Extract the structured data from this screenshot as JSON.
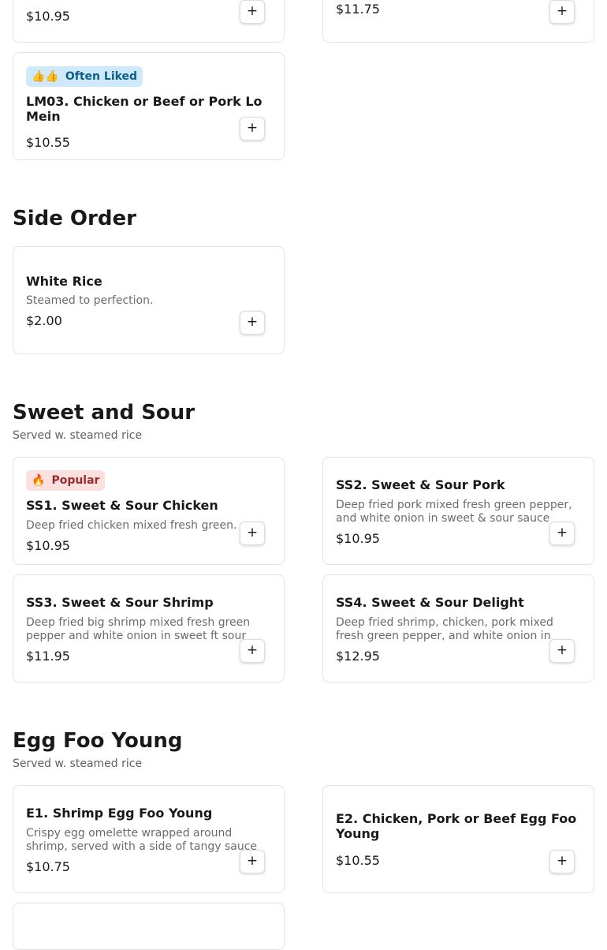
{
  "top_partial": {
    "left": {
      "price": "$10.95",
      "add_label": "+"
    },
    "right": {
      "price": "$11.75",
      "add_label": "+"
    }
  },
  "lomein": {
    "badge": {
      "icon": "👍👍",
      "label": "Often Liked"
    },
    "name": "LM03. Chicken or Beef or Pork Lo Mein",
    "price": "$10.55",
    "add_label": "+"
  },
  "side_order": {
    "title": "Side Order",
    "items": [
      {
        "name": "White Rice",
        "description": "Steamed to perfection.",
        "price": "$2.00",
        "add_label": "+"
      }
    ]
  },
  "sweet_sour": {
    "title": "Sweet and Sour",
    "subtitle": "Served w. steamed rice",
    "items": [
      {
        "badge": {
          "icon": "🔥",
          "label": "Popular"
        },
        "name": "SS1. Sweet & Sour Chicken",
        "description": "Deep fried chicken mixed fresh green.",
        "price": "$10.95",
        "add_label": "+"
      },
      {
        "name": "SS2. Sweet & Sour Pork",
        "description": "Deep fried pork mixed fresh green pepper, and white onion in sweet & sour sauce",
        "price": "$10.95",
        "add_label": "+"
      },
      {
        "name": "SS3. Sweet & Sour Shrimp",
        "description": "Deep fried big shrimp mixed fresh green pepper and white onion in sweet ft sour sauce",
        "price": "$11.95",
        "add_label": "+"
      },
      {
        "name": "SS4. Sweet & Sour Delight",
        "description": "Deep fried shrimp, chicken, pork mixed fresh green pepper, and white onion in sweet & sour sauce",
        "price": "$12.95",
        "add_label": "+"
      }
    ]
  },
  "egg_foo_young": {
    "title": "Egg Foo Young",
    "subtitle": "Served w. steamed rice",
    "items": [
      {
        "name": "E1. Shrimp Egg Foo Young",
        "description": "Crispy egg omelette wrapped around shrimp, served with a side of tangy sauce",
        "price": "$10.75",
        "add_label": "+"
      },
      {
        "name": "E2. Chicken, Pork or Beef Egg Foo Young",
        "price": "$10.55",
        "add_label": "+"
      }
    ]
  },
  "colors": {
    "badge_liked_bg": "#cfe8fa",
    "badge_liked_text": "#0b5f8a",
    "badge_popular_bg": "#fbe0e0",
    "badge_popular_text": "#9b2c2c",
    "card_border": "#e2e2e2",
    "description_text": "#6b6b6b"
  }
}
